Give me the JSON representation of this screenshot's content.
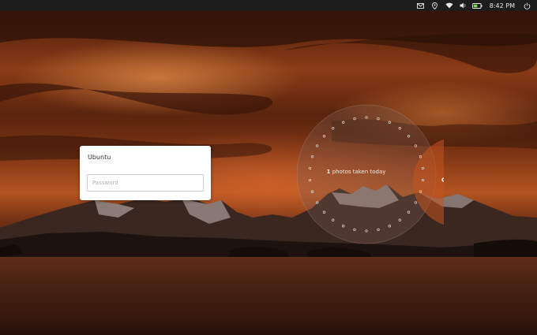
{
  "topbar": {
    "indicators": [
      {
        "icon": "mail-icon"
      },
      {
        "icon": "location-icon"
      },
      {
        "icon": "wifi-icon"
      },
      {
        "icon": "volume-icon"
      },
      {
        "icon": "battery-icon"
      }
    ],
    "clock": "8:42 PM",
    "session_icon": "power-icon"
  },
  "login": {
    "username": "Ubuntu",
    "password_placeholder": "Password"
  },
  "infographic": {
    "count": "1",
    "label": "photos taken today"
  },
  "colors": {
    "topbar_bg": "#1d1d1d",
    "accent_bubble": "#c4541f"
  }
}
